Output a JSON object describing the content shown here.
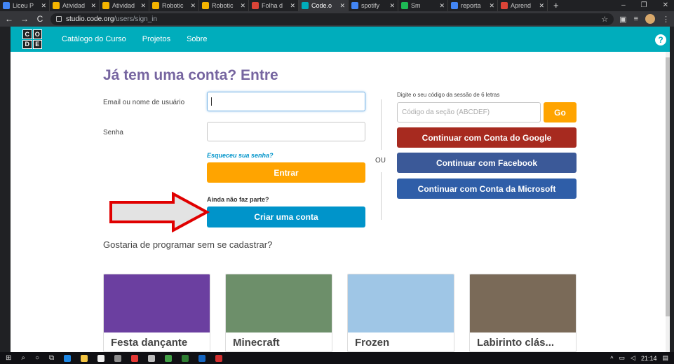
{
  "browser": {
    "tabs": [
      {
        "title": "Liceu P",
        "color": "#4285f4",
        "active": false
      },
      {
        "title": "Atividad",
        "color": "#f4b400",
        "active": false
      },
      {
        "title": "Atividad",
        "color": "#f4b400",
        "active": false
      },
      {
        "title": "Robotic",
        "color": "#f4b400",
        "active": false
      },
      {
        "title": "Robotic",
        "color": "#f4b400",
        "active": false
      },
      {
        "title": "Folha d",
        "color": "#db4437",
        "active": false
      },
      {
        "title": "Code.o",
        "color": "#00adbc",
        "active": true
      },
      {
        "title": "spotify",
        "color": "#4285f4",
        "active": false
      },
      {
        "title": "Sm",
        "color": "#1db954",
        "active": false
      },
      {
        "title": "reporta",
        "color": "#4285f4",
        "active": false
      },
      {
        "title": "Aprend",
        "color": "#db4437",
        "active": false
      }
    ],
    "new_tab": "+",
    "url_host": "studio.code.org",
    "url_path": "/users/sign_in"
  },
  "header": {
    "logo": [
      "C",
      "O",
      "D",
      "E"
    ],
    "nav": [
      "Catálogo do Curso",
      "Projetos",
      "Sobre"
    ],
    "help": "?"
  },
  "signin": {
    "heading": "Já tem uma conta? Entre",
    "email_label": "Email ou nome de usuário",
    "password_label": "Senha",
    "forgot": "Esqueceu sua senha?",
    "submit": "Entrar",
    "no_account": "Ainda não faz parte?",
    "create": "Criar uma conta",
    "or": "OU"
  },
  "section": {
    "label": "Digite o seu código da sessão de 6 letras",
    "placeholder": "Código da seção (ABCDEF)",
    "go": "Go"
  },
  "oauth": {
    "google": "Continuar com Conta do Google",
    "facebook": "Continuar com Facebook",
    "microsoft": "Continuar com Conta da Microsoft"
  },
  "colors": {
    "accent": "#00adbc",
    "heading": "#7665a0",
    "orange": "#ffa400",
    "blue": "#0094ca",
    "google": "#a72a1f",
    "facebook": "#3b5998",
    "microsoft": "#2f5ea8",
    "arrow": "#e00000"
  },
  "no_signup": "Gostaria de programar sem se cadastrar?",
  "activities": [
    {
      "title": "Festa dançante",
      "bg": "#6b3fa0"
    },
    {
      "title": "Minecraft",
      "bg": "#6d8f6a"
    },
    {
      "title": "Frozen",
      "bg": "#9fc6e6"
    },
    {
      "title": "Labirinto clás...",
      "bg": "#7a6a58"
    }
  ],
  "taskbar": {
    "clock": "21:14"
  }
}
